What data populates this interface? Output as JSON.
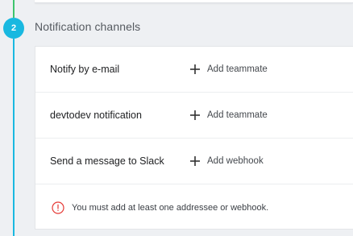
{
  "step": {
    "number": "2",
    "title": "Notification channels"
  },
  "channels": [
    {
      "label": "Notify by e-mail",
      "action": "Add teammate",
      "action_icon": "plus-icon"
    },
    {
      "label": "devtodev notification",
      "action": "Add teammate",
      "action_icon": "plus-icon"
    },
    {
      "label": "Send a message to Slack",
      "action": "Add webhook",
      "action_icon": "plus-icon"
    }
  ],
  "warning": {
    "icon": "exclamation-circle-icon",
    "text": "You must add at least one addressee or webhook."
  },
  "colors": {
    "accent": "#19b8e0",
    "completed_line": "#3ec46d",
    "error": "#e53935"
  }
}
